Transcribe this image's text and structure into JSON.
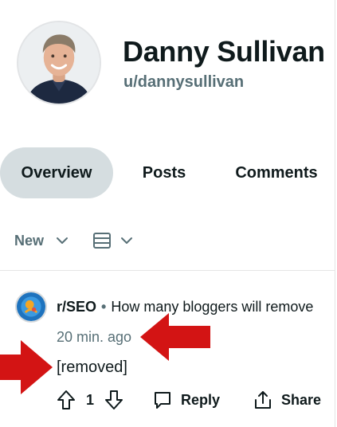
{
  "profile": {
    "display_name": "Danny Sullivan",
    "username": "u/dannysullivan"
  },
  "tabs": [
    {
      "label": "Overview",
      "active": true
    },
    {
      "label": "Posts",
      "active": false
    },
    {
      "label": "Comments",
      "active": false
    }
  ],
  "sort": {
    "label": "New",
    "icons": [
      "chevron-down-icon",
      "view-list-icon"
    ]
  },
  "comment": {
    "subreddit": "r/SEO",
    "separator": "•",
    "post_title": "How many bloggers will remove",
    "timestamp": "20 min. ago",
    "body": "[removed]",
    "vote_count": "1",
    "reply_label": "Reply",
    "share_label": "Share"
  },
  "colors": {
    "accent_red": "#d31414",
    "tab_active_bg": "#d5dde0",
    "muted_text": "#576f76"
  }
}
